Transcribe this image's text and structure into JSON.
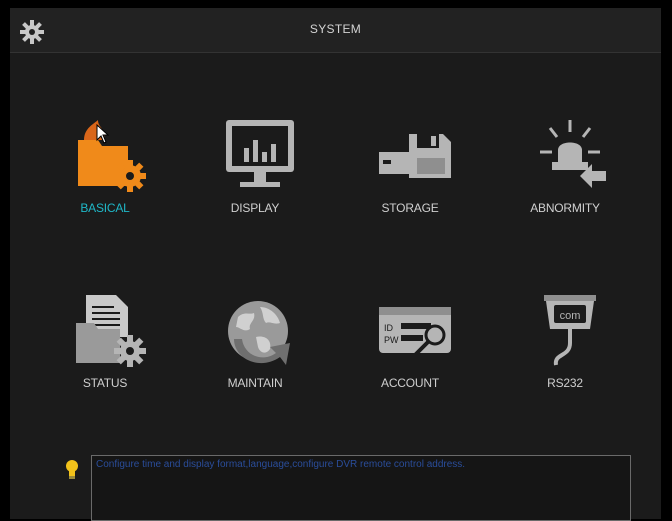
{
  "window": {
    "title": "SYSTEM"
  },
  "menu": {
    "items": [
      {
        "label": "BASICAL",
        "icon": "basic-settings-icon",
        "selected": true
      },
      {
        "label": "DISPLAY",
        "icon": "monitor-chart-icon"
      },
      {
        "label": "STORAGE",
        "icon": "disk-drive-icon"
      },
      {
        "label": "ABNORMITY",
        "icon": "alarm-light-icon"
      },
      {
        "label": "STATUS",
        "icon": "document-gear-icon"
      },
      {
        "label": "MAINTAIN",
        "icon": "globe-refresh-icon"
      },
      {
        "label": "ACCOUNT",
        "icon": "id-card-key-icon"
      },
      {
        "label": "RS232",
        "icon": "com-port-icon"
      }
    ]
  },
  "tip": {
    "text": "Configure time and display format,language,configure DVR remote control address."
  },
  "colors": {
    "selected_label": "#1fb7c7",
    "accent_orange": "#f08a1a",
    "icon_gray": "#b5b5b5"
  }
}
